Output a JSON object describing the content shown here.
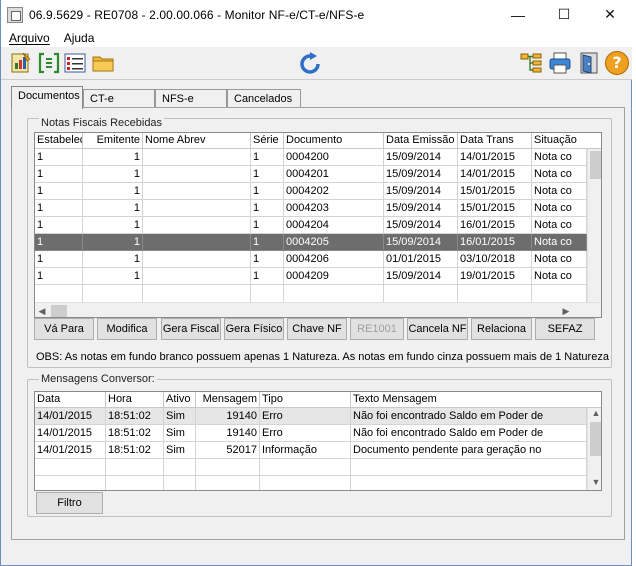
{
  "window": {
    "title": "06.9.5629 - RE0708 - 2.00.00.066 - Monitor NF-e/CT-e/NFS-e",
    "minimize": "—",
    "maximize": "☐",
    "close": "✕"
  },
  "menu": [
    "Arquivo",
    "Ajuda"
  ],
  "toolbar": {
    "icons": [
      "report-icon",
      "bracket-data-icon",
      "list-options-icon",
      "folder-icon",
      "refresh-icon",
      "tree-structure-icon",
      "print-icon",
      "exit-door-icon",
      "help-icon"
    ],
    "help_glyph": "?"
  },
  "tabs": [
    "Documentos",
    "CT-e",
    "NFS-e",
    "Cancelados"
  ],
  "nfr": {
    "group_label": "Notas Fiscais Recebidas",
    "columns": [
      "Estabelec",
      "Emitente",
      "Nome Abrev",
      "Série",
      "Documento",
      "Data Emissão",
      "Data Trans",
      "Situação"
    ],
    "rows": [
      {
        "estab": "1",
        "emitente": "1",
        "nome": "",
        "serie": "1",
        "documento": "0004200",
        "emissao": "15/09/2014",
        "trans": "14/01/2015",
        "situacao": "Nota co"
      },
      {
        "estab": "1",
        "emitente": "1",
        "nome": "",
        "serie": "1",
        "documento": "0004201",
        "emissao": "15/09/2014",
        "trans": "14/01/2015",
        "situacao": "Nota co"
      },
      {
        "estab": "1",
        "emitente": "1",
        "nome": "",
        "serie": "1",
        "documento": "0004202",
        "emissao": "15/09/2014",
        "trans": "15/01/2015",
        "situacao": "Nota co"
      },
      {
        "estab": "1",
        "emitente": "1",
        "nome": "",
        "serie": "1",
        "documento": "0004203",
        "emissao": "15/09/2014",
        "trans": "15/01/2015",
        "situacao": "Nota co"
      },
      {
        "estab": "1",
        "emitente": "1",
        "nome": "",
        "serie": "1",
        "documento": "0004204",
        "emissao": "15/09/2014",
        "trans": "16/01/2015",
        "situacao": "Nota co"
      },
      {
        "estab": "1",
        "emitente": "1",
        "nome": "",
        "serie": "1",
        "documento": "0004205",
        "emissao": "15/09/2014",
        "trans": "16/01/2015",
        "situacao": "Nota co"
      },
      {
        "estab": "1",
        "emitente": "1",
        "nome": "",
        "serie": "1",
        "documento": "0004206",
        "emissao": "01/01/2015",
        "trans": "03/10/2018",
        "situacao": "Nota co"
      },
      {
        "estab": "1",
        "emitente": "1",
        "nome": "",
        "serie": "1",
        "documento": "0004209",
        "emissao": "15/09/2014",
        "trans": "19/01/2015",
        "situacao": "Nota co"
      }
    ],
    "selected_row": 5,
    "buttons": [
      "Vá Para",
      "Modifica",
      "Gera Fiscal",
      "Gera Físico",
      "Chave NF",
      "RE1001",
      "Cancela NF",
      "Relaciona",
      "SEFAZ"
    ],
    "obs": "OBS: As notas em fundo branco possuem apenas 1 Natureza. As notas em fundo cinza possuem mais de 1 Natureza"
  },
  "msgs": {
    "group_label": "Mensagens Conversor:",
    "columns": [
      "Data",
      "Hora",
      "Ativo",
      "Mensagem",
      "Tipo",
      "Texto Mensagem"
    ],
    "rows": [
      {
        "data": "14/01/2015",
        "hora": "18:51:02",
        "ativo": "Sim",
        "mensagem": "19140",
        "tipo": "Erro",
        "texto": "Não foi encontrado Saldo em Poder de"
      },
      {
        "data": "14/01/2015",
        "hora": "18:51:02",
        "ativo": "Sim",
        "mensagem": "19140",
        "tipo": "Erro",
        "texto": "Não foi encontrado Saldo em Poder de"
      },
      {
        "data": "14/01/2015",
        "hora": "18:51:02",
        "ativo": "Sim",
        "mensagem": "52017",
        "tipo": "Informação",
        "texto": "Documento pendente para geração no"
      }
    ],
    "filter_button": "Filtro"
  }
}
